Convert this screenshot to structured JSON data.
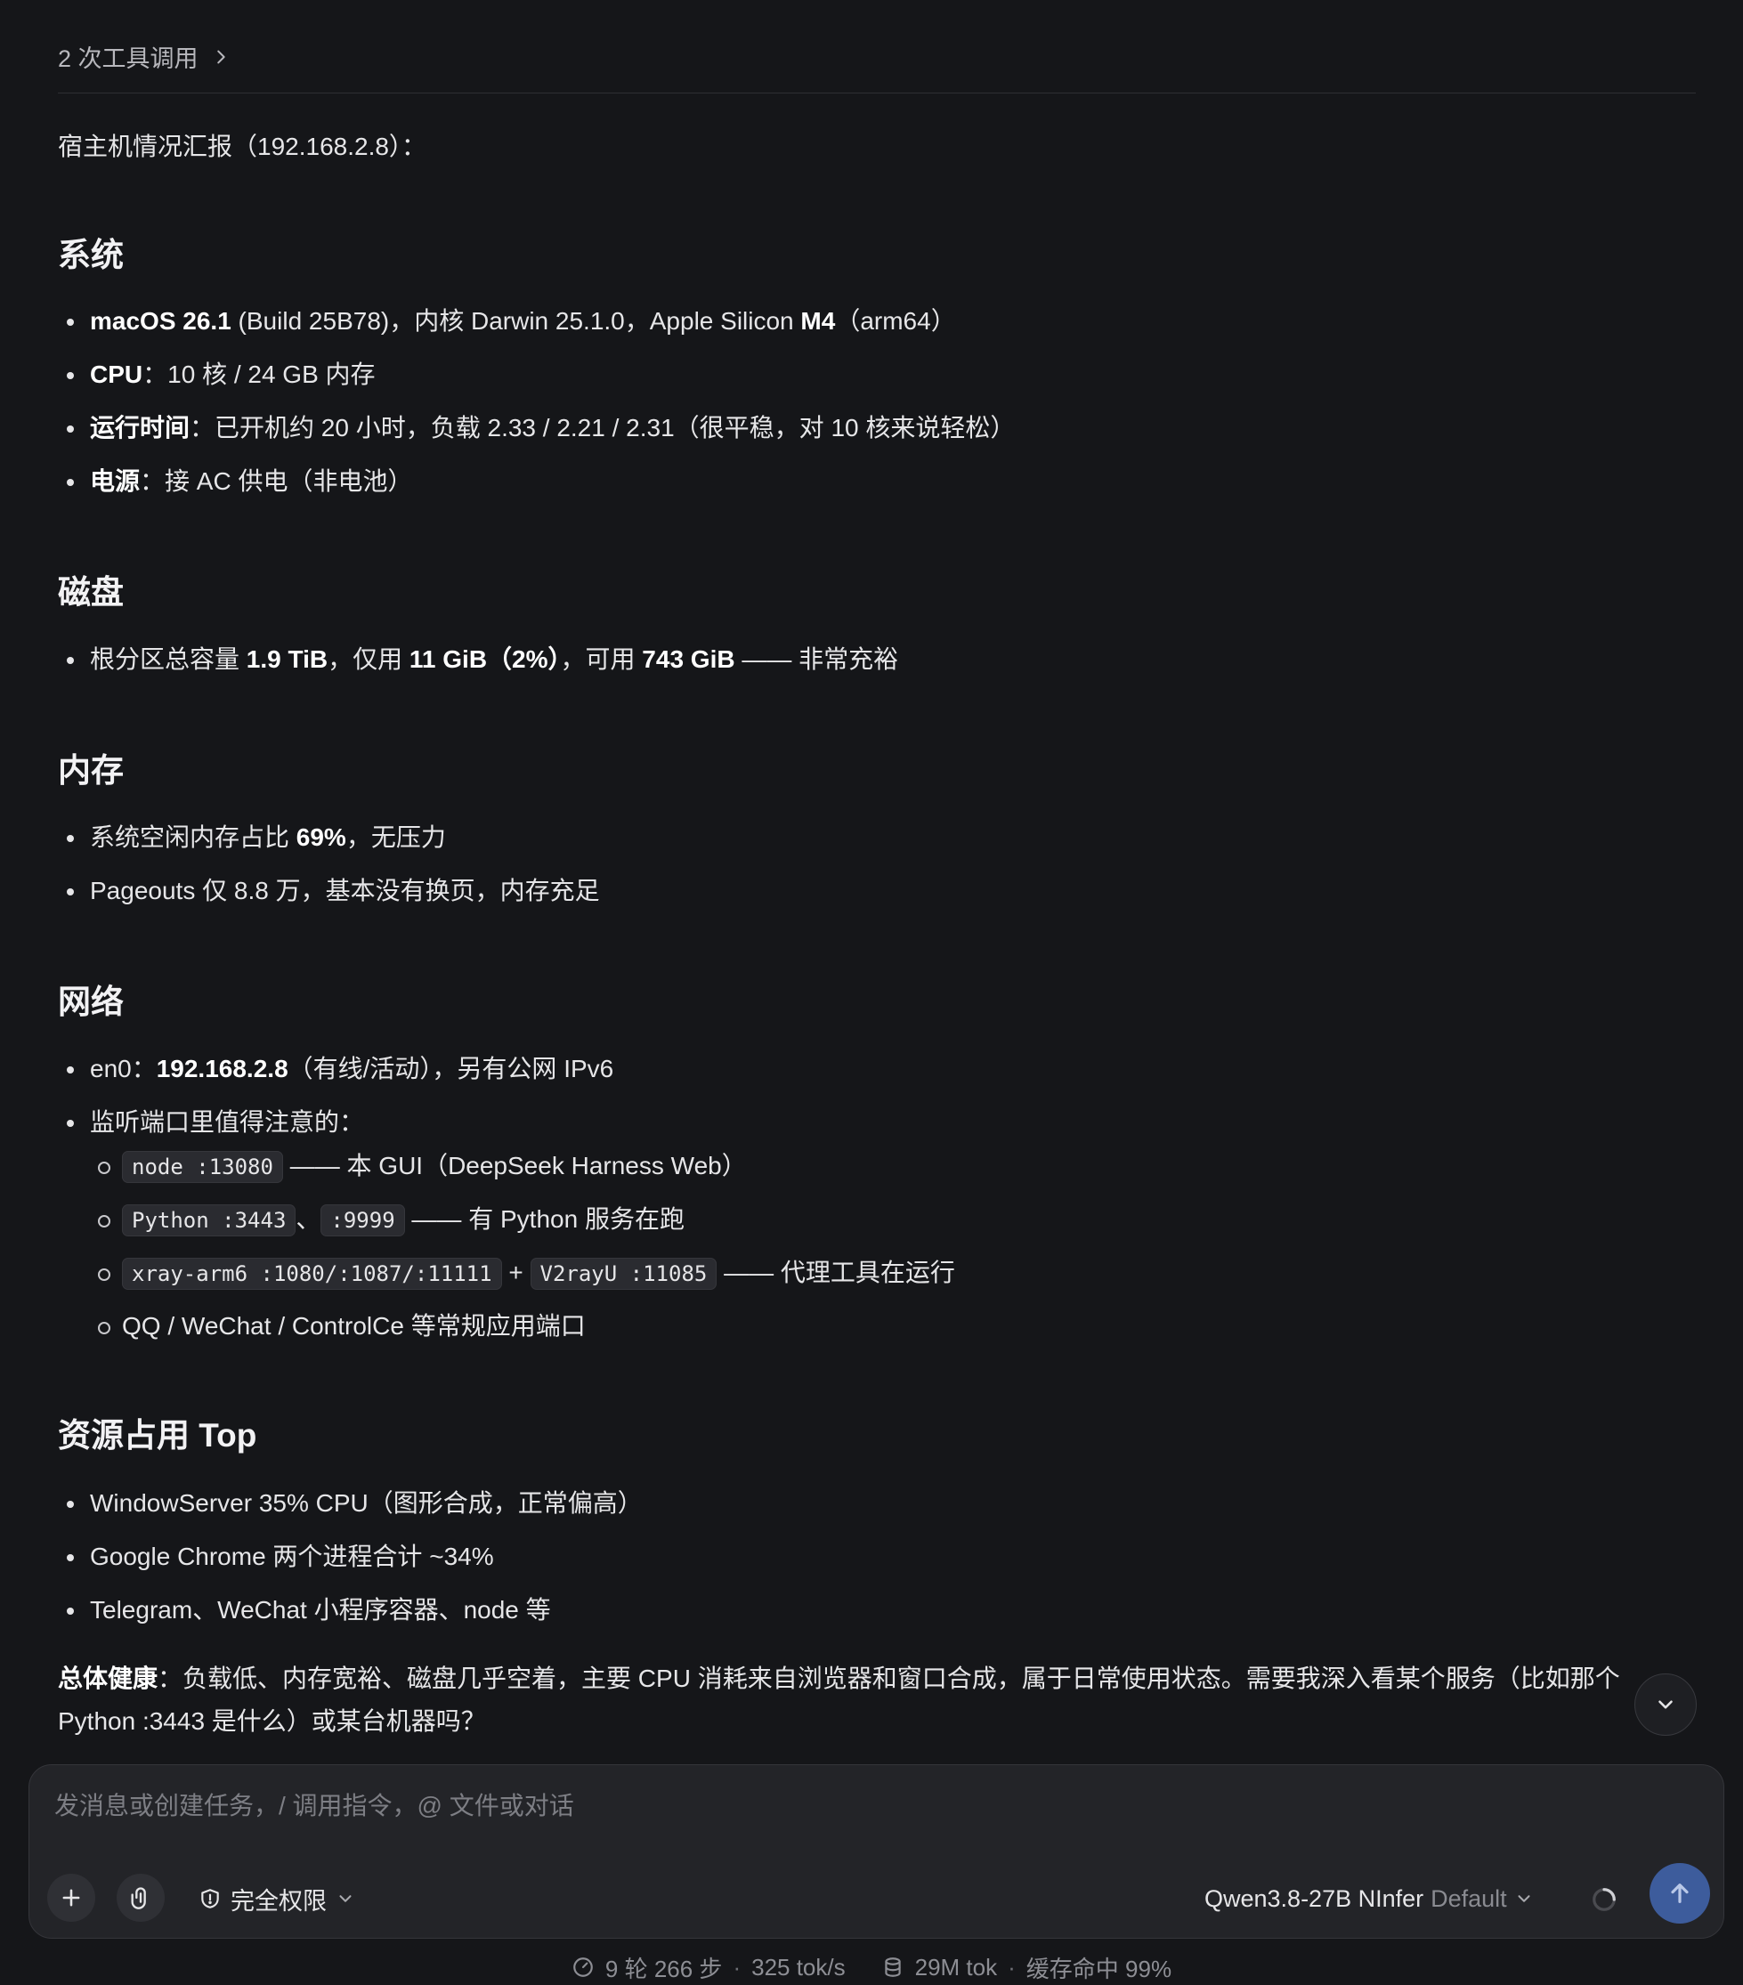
{
  "tool_calls": {
    "label": "2 次工具调用"
  },
  "intro": "宿主机情况汇报（192.168.2.8）：",
  "sections": {
    "system": {
      "title": "系统",
      "item1": {
        "b1": "macOS 26.1",
        "t1": " (Build 25B78)，内核 Darwin 25.1.0，Apple Silicon ",
        "b2": "M4",
        "t2": "（arm64）"
      },
      "item2": {
        "b": "CPU",
        "t": "：10 核 / 24 GB 内存"
      },
      "item3": {
        "b": "运行时间",
        "t": "：已开机约 20 小时，负载 2.33 / 2.21 / 2.31（很平稳，对 10 核来说轻松）"
      },
      "item4": {
        "b": "电源",
        "t": "：接 AC 供电（非电池）"
      }
    },
    "disk": {
      "title": "磁盘",
      "item1": {
        "t1": "根分区总容量 ",
        "b1": "1.9 TiB",
        "t2": "，仅用 ",
        "b2": "11 GiB（2%）",
        "t3": "，可用 ",
        "b3": "743 GiB",
        "t4": " —— 非常充裕"
      }
    },
    "memory": {
      "title": "内存",
      "item1": {
        "t1": "系统空闲内存占比 ",
        "b1": "69%",
        "t2": "，无压力"
      },
      "item2": {
        "t": "Pageouts 仅 8.8 万，基本没有换页，内存充足"
      }
    },
    "network": {
      "title": "网络",
      "item1": {
        "t1": "en0：",
        "b1": "192.168.2.8",
        "t2": "（有线/活动），另有公网 IPv6"
      },
      "item2": {
        "t": "监听端口里值得注意的："
      },
      "sub1": {
        "c1": "node :13080",
        "t1": " —— 本 GUI（DeepSeek Harness Web）"
      },
      "sub2": {
        "c1": "Python :3443",
        "t1": "、",
        "c2": ":9999",
        "t2": " —— 有 Python 服务在跑"
      },
      "sub3": {
        "c1": "xray-arm6 :1080/:1087/:11111",
        "t1": " + ",
        "c2": "V2rayU :11085",
        "t2": " —— 代理工具在运行"
      },
      "sub4": {
        "t": "QQ / WeChat / ControlCe 等常规应用端口"
      }
    },
    "top": {
      "title": "资源占用 Top",
      "item1": {
        "t": "WindowServer 35% CPU（图形合成，正常偏高）"
      },
      "item2": {
        "t": "Google Chrome 两个进程合计 ~34%"
      },
      "item3": {
        "t": "Telegram、WeChat 小程序容器、node 等"
      }
    }
  },
  "summary": {
    "b": "总体健康",
    "t": "：负载低、内存宽裕、磁盘几乎空着，主要 CPU 消耗来自浏览器和窗口合成，属于日常使用状态。需要我深入看某个服务（比如那个 Python :3443 是什么）或某台机器吗？"
  },
  "composer": {
    "placeholder": "发消息或创建任务，/ 调用指令，@ 文件或对话",
    "permission": "完全权限",
    "model": "Qwen3.8-27B NInfer",
    "model_profile": "Default"
  },
  "status": {
    "turns": "9 轮 266 步",
    "speed": "325 tok/s",
    "tokens": "29M tok",
    "cache": "缓存命中 99%"
  },
  "colors": {
    "accent": "#3d5c9c",
    "background": "#151619",
    "composer": "#232428"
  }
}
